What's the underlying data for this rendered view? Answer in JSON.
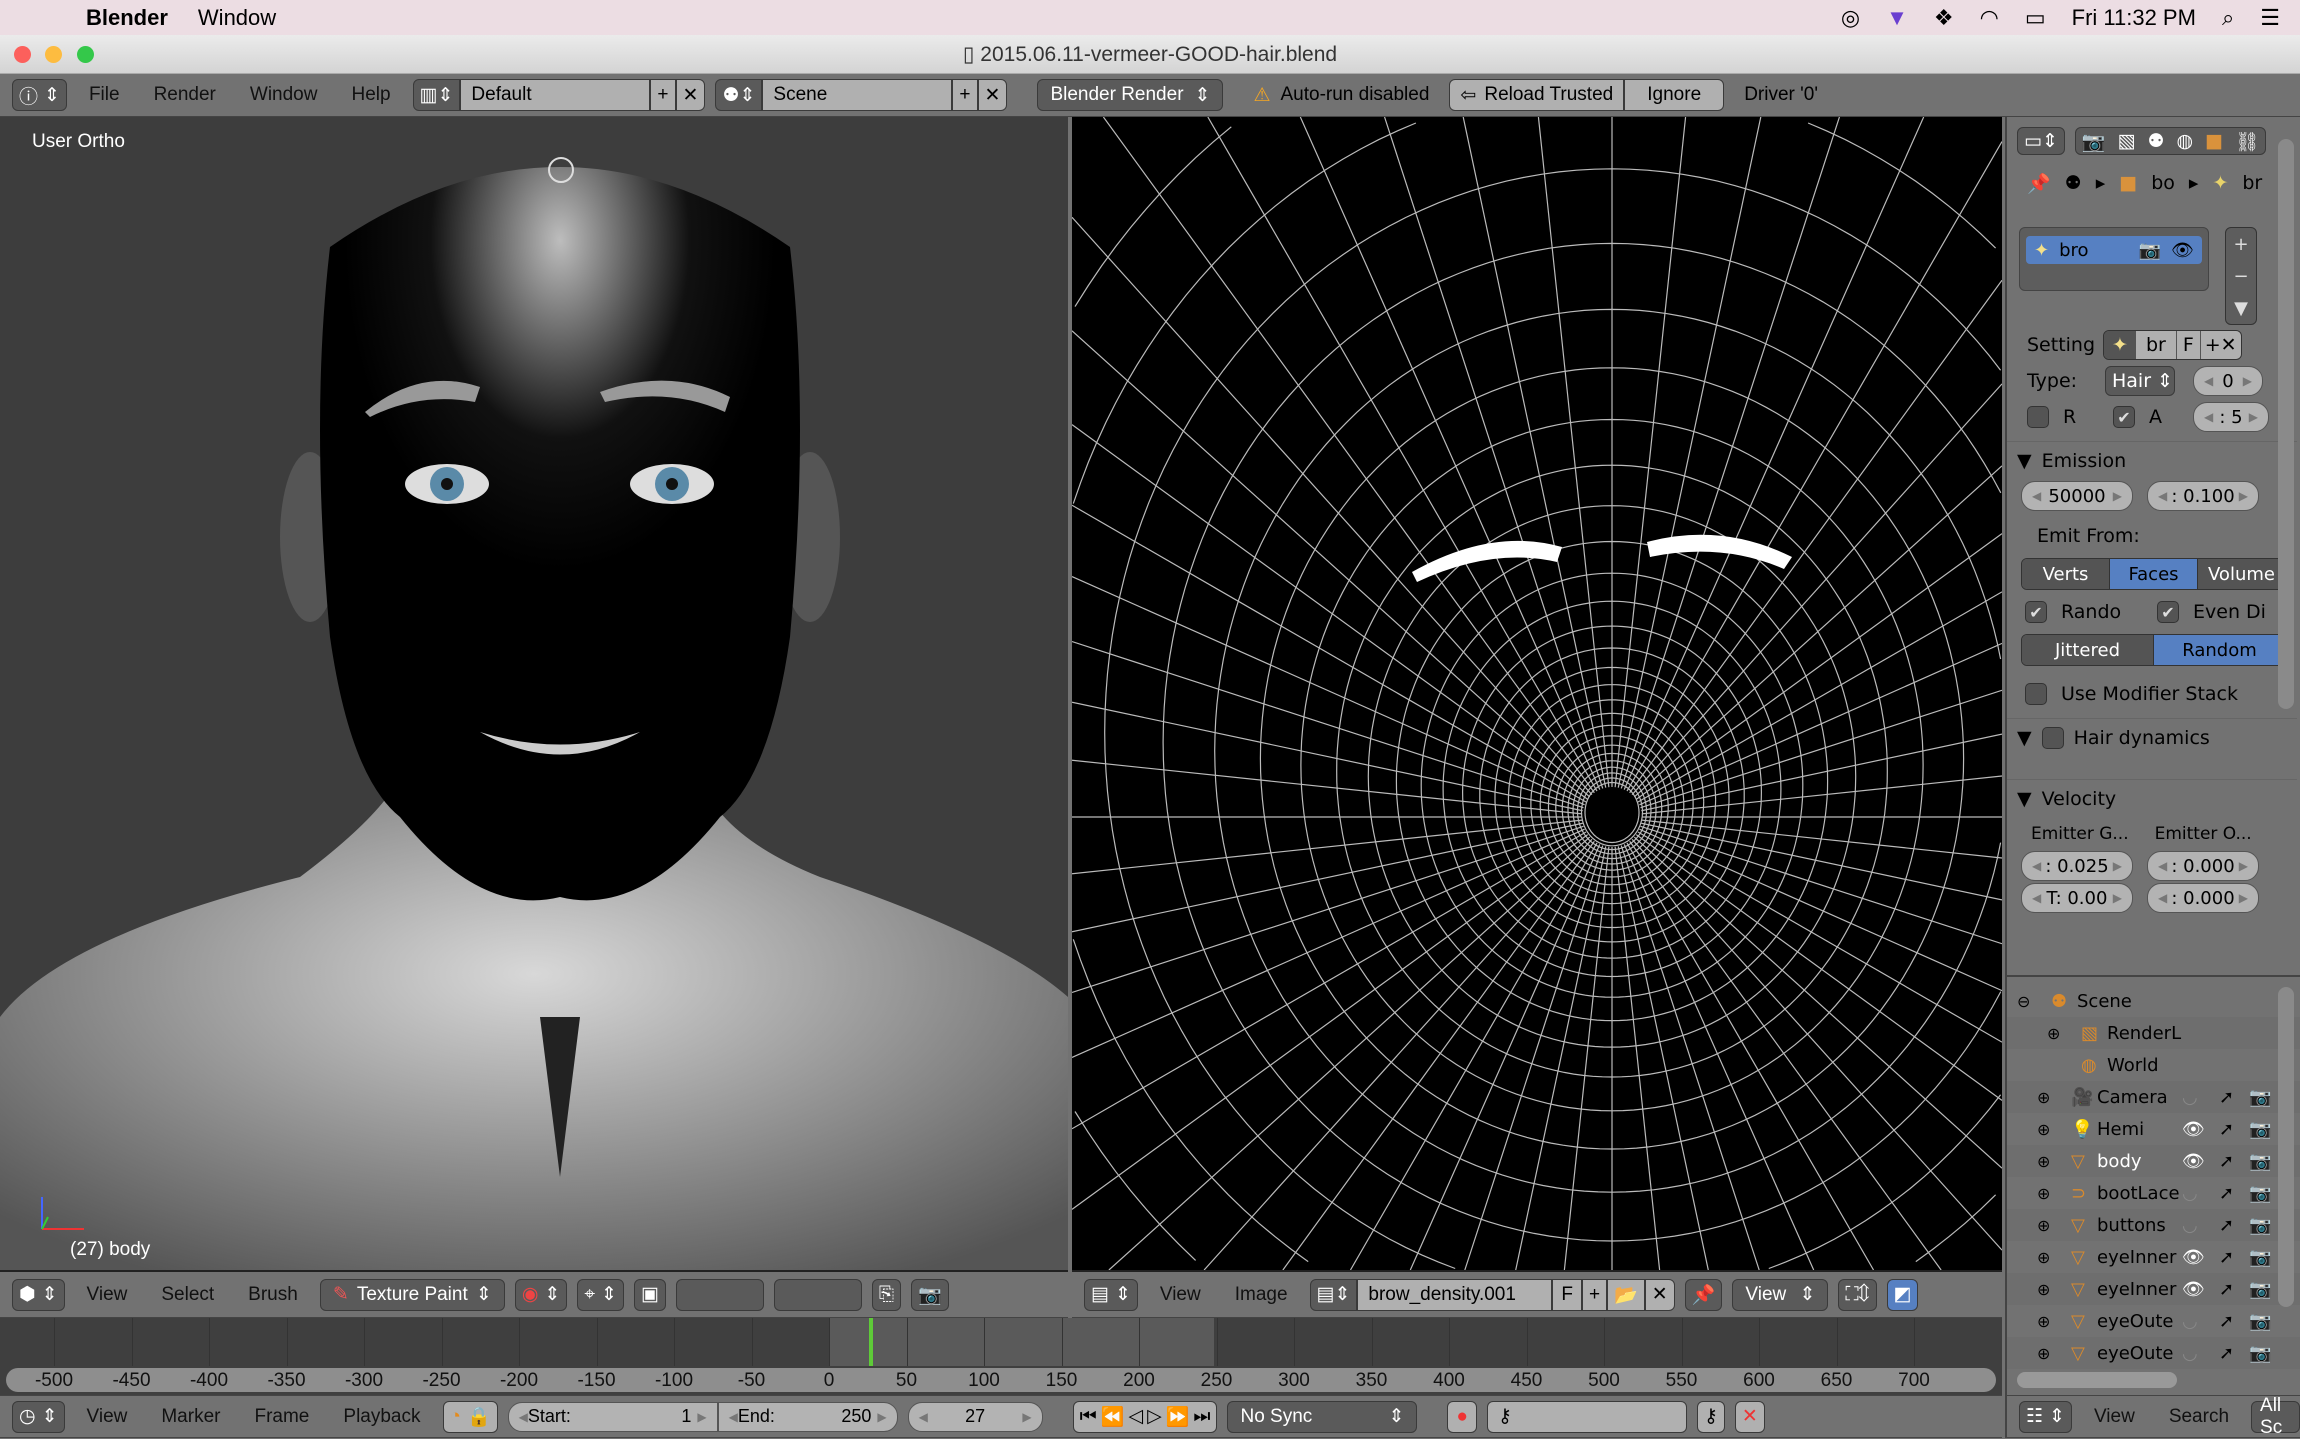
{
  "macos": {
    "app": "Blender",
    "menus": [
      "Window"
    ],
    "clock": "Fri 11:32 PM"
  },
  "window": {
    "title": "2015.06.11-vermeer-GOOD-hair.blend"
  },
  "top_header": {
    "menus": [
      "File",
      "Render",
      "Window",
      "Help"
    ],
    "layout": "Default",
    "scene": "Scene",
    "engine": "Blender Render",
    "warning": "Auto-run disabled",
    "reload": "Reload Trusted",
    "ignore": "Ignore",
    "driver": "Driver '0'"
  },
  "viewport": {
    "label": "User Ortho",
    "object_info": "(27) body",
    "menus": [
      "View",
      "Select",
      "Brush"
    ],
    "mode": "Texture Paint"
  },
  "uv_editor": {
    "menus": [
      "View",
      "Image"
    ],
    "image": "brow_density.001",
    "fake_user": "F",
    "view": "View"
  },
  "properties": {
    "breadcrumb": [
      "bo",
      "br"
    ],
    "system_name": "bro",
    "settings_label": "Setting",
    "settings_name": "br",
    "settings_f": "F",
    "type_label": "Type:",
    "type_value": "Hair",
    "seed": "0",
    "r_label": "R",
    "a_label": "A",
    "a_value": ": 5",
    "emission": {
      "title": "Emission",
      "number": "50000",
      "seed": ": 0.100",
      "emit_from": "Emit From:",
      "options": [
        "Verts",
        "Faces",
        "Volume"
      ],
      "selected": "Faces",
      "random": "Rando",
      "even": "Even Di",
      "dist": [
        "Jittered",
        "Random"
      ],
      "dist_selected": "Random",
      "modifier": "Use Modifier Stack"
    },
    "hair_dynamics": "Hair dynamics",
    "velocity": {
      "title": "Velocity",
      "col1": "Emitter G...",
      "col2": "Emitter O...",
      "v1": ": 0.025",
      "v2": "T: 0.00",
      "v3": ": 0.000",
      "v4": ": 0.000"
    }
  },
  "outliner": {
    "items": [
      {
        "name": "Scene",
        "icon": "scene-icon"
      },
      {
        "name": "RenderL",
        "icon": "render-layers-icon"
      },
      {
        "name": "World",
        "icon": "world-icon"
      },
      {
        "name": "Camera",
        "icon": "camera-icon",
        "visible": false
      },
      {
        "name": "Hemi",
        "icon": "lamp-icon",
        "visible": true
      },
      {
        "name": "body",
        "icon": "mesh-icon",
        "visible": true,
        "active": true
      },
      {
        "name": "bootLace",
        "icon": "curve-icon",
        "visible": false
      },
      {
        "name": "buttons",
        "icon": "mesh-icon",
        "visible": false
      },
      {
        "name": "eyeInner",
        "icon": "mesh-icon",
        "visible": true
      },
      {
        "name": "eyeInner",
        "icon": "mesh-icon",
        "visible": true
      },
      {
        "name": "eyeOute",
        "icon": "mesh-icon",
        "visible": false
      },
      {
        "name": "eyeOute",
        "icon": "mesh-icon",
        "visible": false
      }
    ],
    "menus": [
      "View",
      "Search"
    ],
    "filter": "All Sc"
  },
  "timeline": {
    "ticks": [
      "-500",
      "-450",
      "-400",
      "-350",
      "-300",
      "-250",
      "-200",
      "-150",
      "-100",
      "-50",
      "0",
      "50",
      "100",
      "150",
      "200",
      "250",
      "300",
      "350",
      "400",
      "450",
      "500",
      "550",
      "600",
      "650",
      "700"
    ],
    "current_frame": 27,
    "start_label": "Start:",
    "start": "1",
    "end_label": "End:",
    "end": "250",
    "frame": "27",
    "menus": [
      "View",
      "Marker",
      "Frame",
      "Playback"
    ],
    "sync": "No Sync"
  },
  "colors": {
    "accent": "#5680c2",
    "current_frame": "#5ecb38",
    "panel": "#727272"
  }
}
